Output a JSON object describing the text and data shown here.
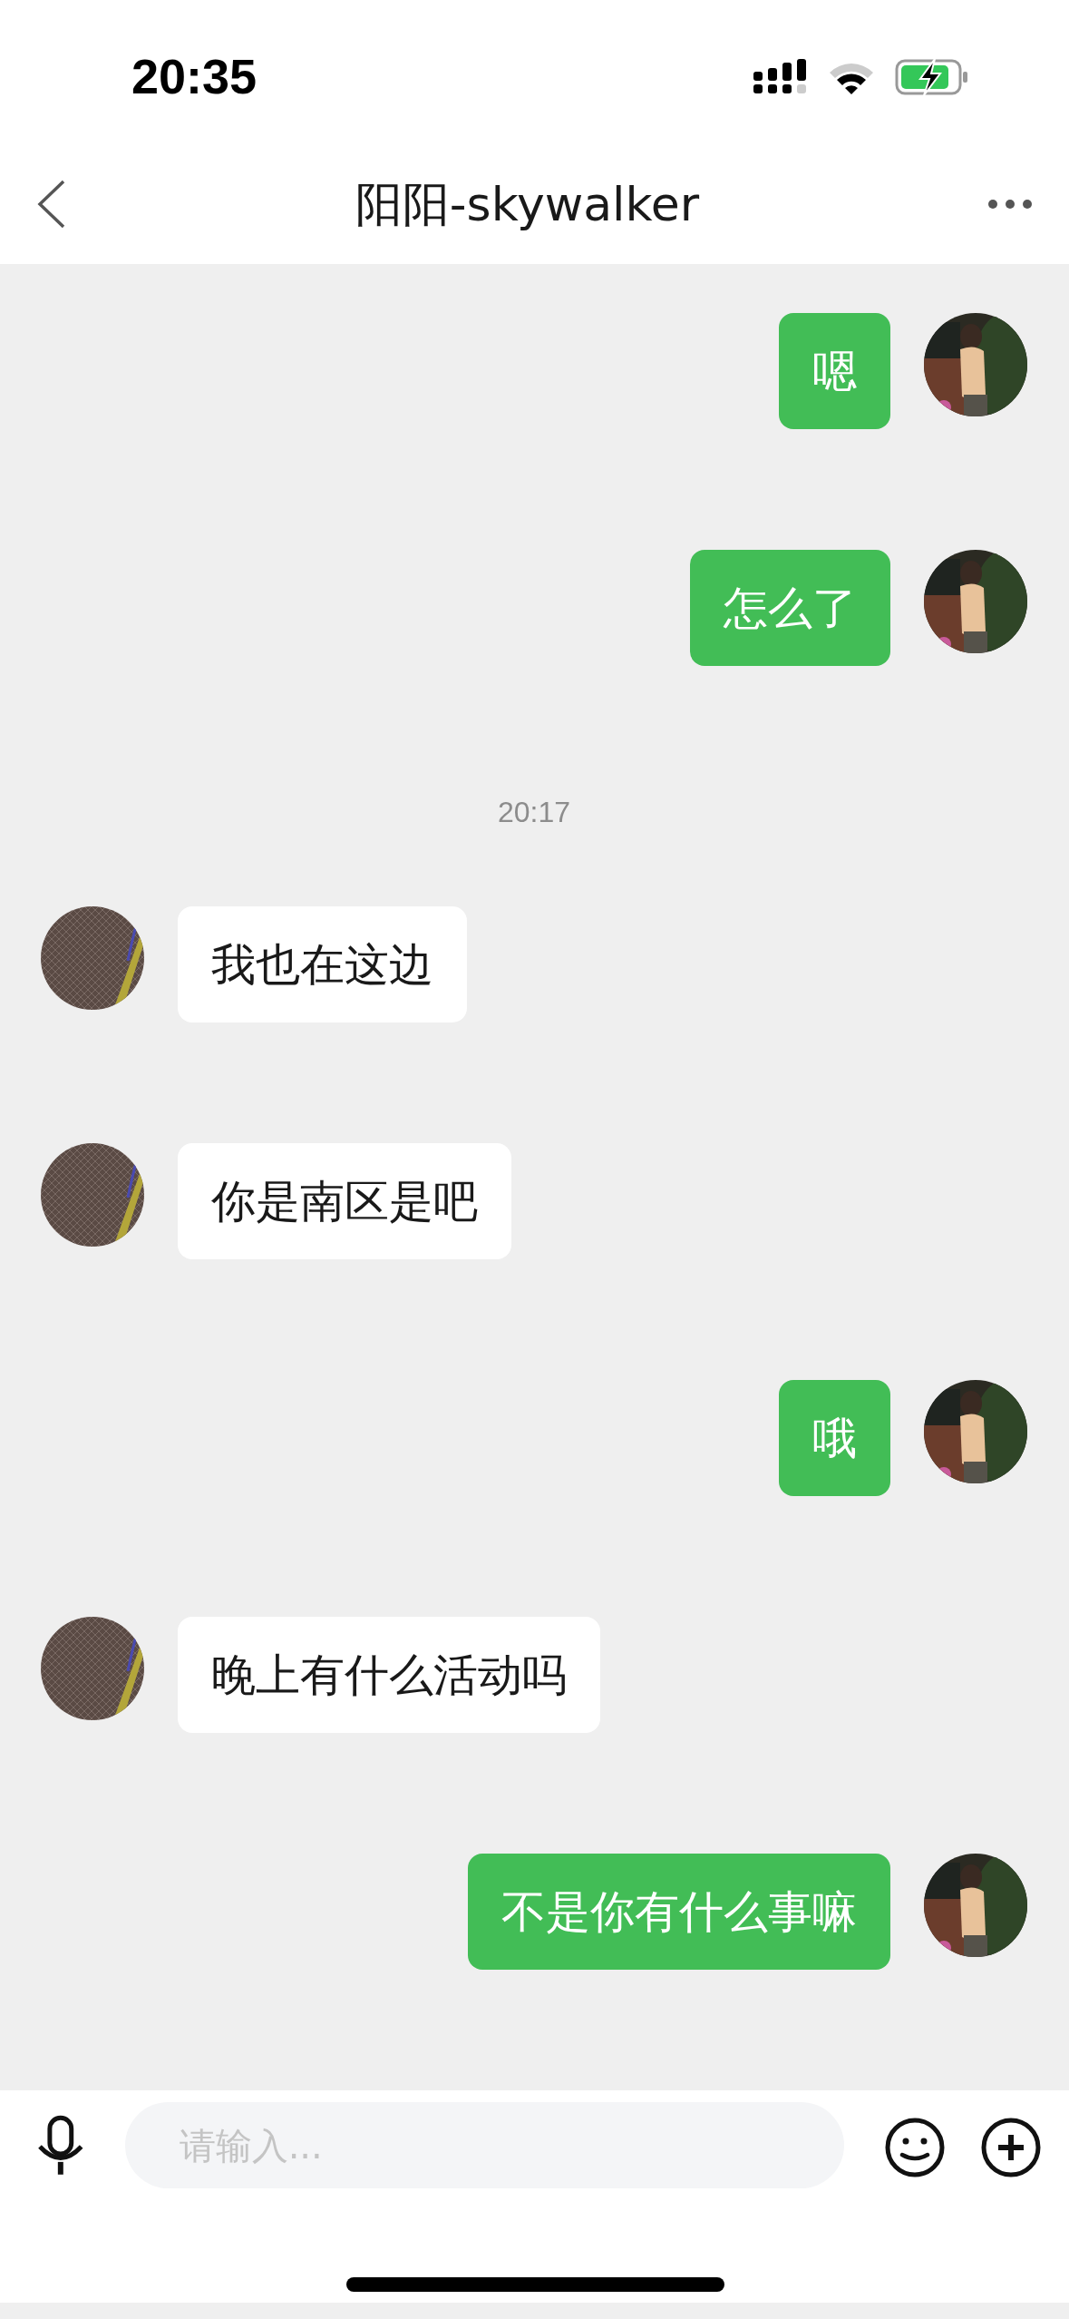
{
  "status_bar": {
    "time": "20:35",
    "battery_charging": true
  },
  "nav_bar": {
    "title": "阳阳-skywalker"
  },
  "messages": [
    {
      "kind": "message",
      "outgoing": true,
      "text": "嗯"
    },
    {
      "kind": "message",
      "outgoing": true,
      "text": "怎么了"
    },
    {
      "kind": "time",
      "text": "20:17"
    },
    {
      "kind": "message",
      "outgoing": false,
      "text": "我也在这边"
    },
    {
      "kind": "message",
      "outgoing": false,
      "text": "你是南区是吧"
    },
    {
      "kind": "message",
      "outgoing": true,
      "text": "哦"
    },
    {
      "kind": "message",
      "outgoing": false,
      "text": "晚上有什么活动吗"
    },
    {
      "kind": "message",
      "outgoing": true,
      "text": "不是你有什么事嘛"
    }
  ],
  "input_bar": {
    "placeholder": "请输入..."
  }
}
